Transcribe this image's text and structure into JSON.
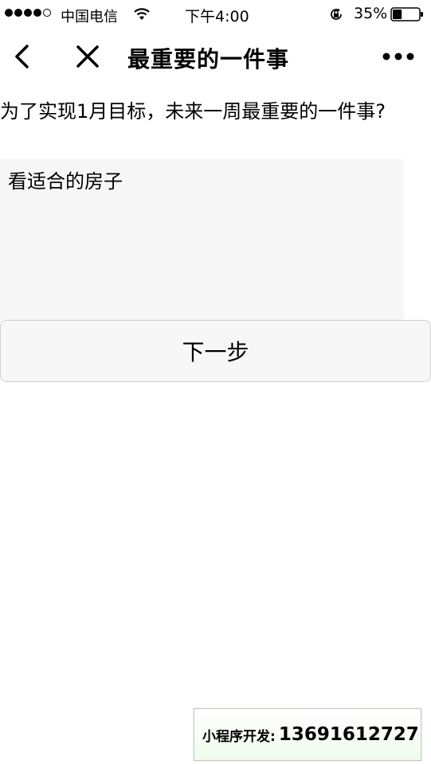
{
  "status_bar": {
    "signal_dots": [
      true,
      true,
      true,
      true,
      false
    ],
    "carrier": "中国电信",
    "wifi_icon": "wifi-icon",
    "time": "下午4:00",
    "lock_icon": "rotation-lock-icon",
    "battery_percent": "35%",
    "battery_level": 0.35
  },
  "nav": {
    "back_icon": "chevron-left-icon",
    "close_icon": "close-icon",
    "title": "最重要的一件事",
    "more_icon": "more-dots-icon"
  },
  "form": {
    "question": "为了实现1月目标，未来一周最重要的一件事?",
    "answer": "看适合的房子",
    "next_label": "下一步"
  },
  "banner": {
    "label": "小程序开发:",
    "phone": "13691612727"
  }
}
